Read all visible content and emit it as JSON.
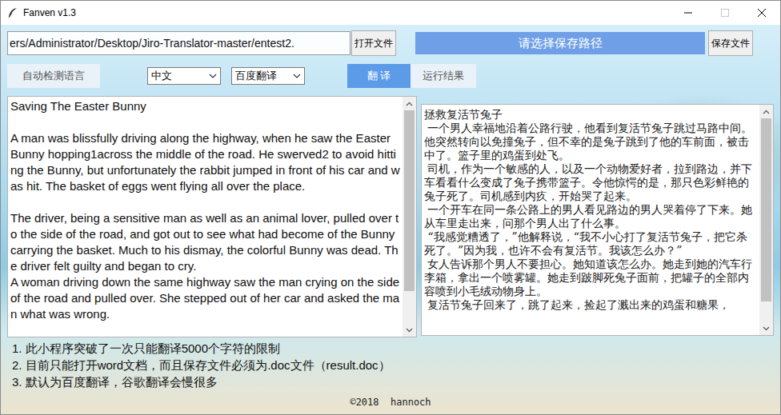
{
  "window": {
    "title": "Fanven v1.3"
  },
  "toolbar": {
    "file_path": "ers/Administrator/Desktop/Jiro-Translator-master/entest2.",
    "open_button": "打开文件",
    "save_path": "请选择保存路径",
    "save_button": "保存文件"
  },
  "options": {
    "source_language": "自动检测语言",
    "target_language": "中文",
    "engine": "百度翻译",
    "translate_button": "翻 译",
    "result_label": "运行结果"
  },
  "source_text": {
    "body": "Saving The Easter Bunny\n\nA man was blissfully driving along the highway, when he saw the Easter Bunny hopping1across the middle of the road. He swerved2 to avoid hitting the Bunny, but unfortunately the rabbit jumped in front of his car and was hit. The basket of eggs went flying all over the place.\n\nThe driver, being a sensitive man as well as an animal lover, pulled over to the side of the road, and got out to see what had become of the Bunny carrying the basket. Much to his dismay, the colorful Bunny was dead. The driver felt guilty and began to cry.\nA woman driving down the same highway saw the man crying on the side of the road and pulled over. She stepped out of her car and asked the man what was wrong.",
    "level": 0.85
  },
  "result_text": {
    "body": "拯救复活节兔子\n 一个男人幸福地沿着公路行驶，他看到复活节兔子跳过马路中间。他突然转向以免撞兔子，但不幸的是兔子跳到了他的车前面，被击中了。篮子里的鸡蛋到处飞。\n 司机，作为一个敏感的人，以及一个动物爱好者，拉到路边，并下车看看什么变成了兔子携带篮子。令他惊愕的是，那只色彩鲜艳的兔子死了。司机感到内疚，开始哭了起来。\n 一个开车在同一条公路上的男人看见路边的男人哭着停了下来。她从车里走出来，问那个男人出了什么事。\n “我感觉糟透了，”他解释说，“我不小心打了复活节兔子，把它杀死了。”因为我，也许不会有复活节。我该怎么办？”\n 女人告诉那个男人不要担心。她知道该怎么办。她走到她的汽车行李箱，拿出一个喷雾罐。她走到跛脚死兔子面前，把罐子的全部内容喷到小毛绒动物身上。\n 复活节兔子回来了，跳了起来，捡起了溅出来的鸡蛋和糖果，",
    "level": 0.9
  },
  "notes": [
    "1. 此小程序突破了一次只能翻译5000个字符的限制",
    "2. 目前只能打开word文档，而且保存文件必须为.doc文件（result.doc）",
    "3. 默认为百度翻译，谷歌翻译会慢很多"
  ],
  "footer": "©2018  hannoch"
}
